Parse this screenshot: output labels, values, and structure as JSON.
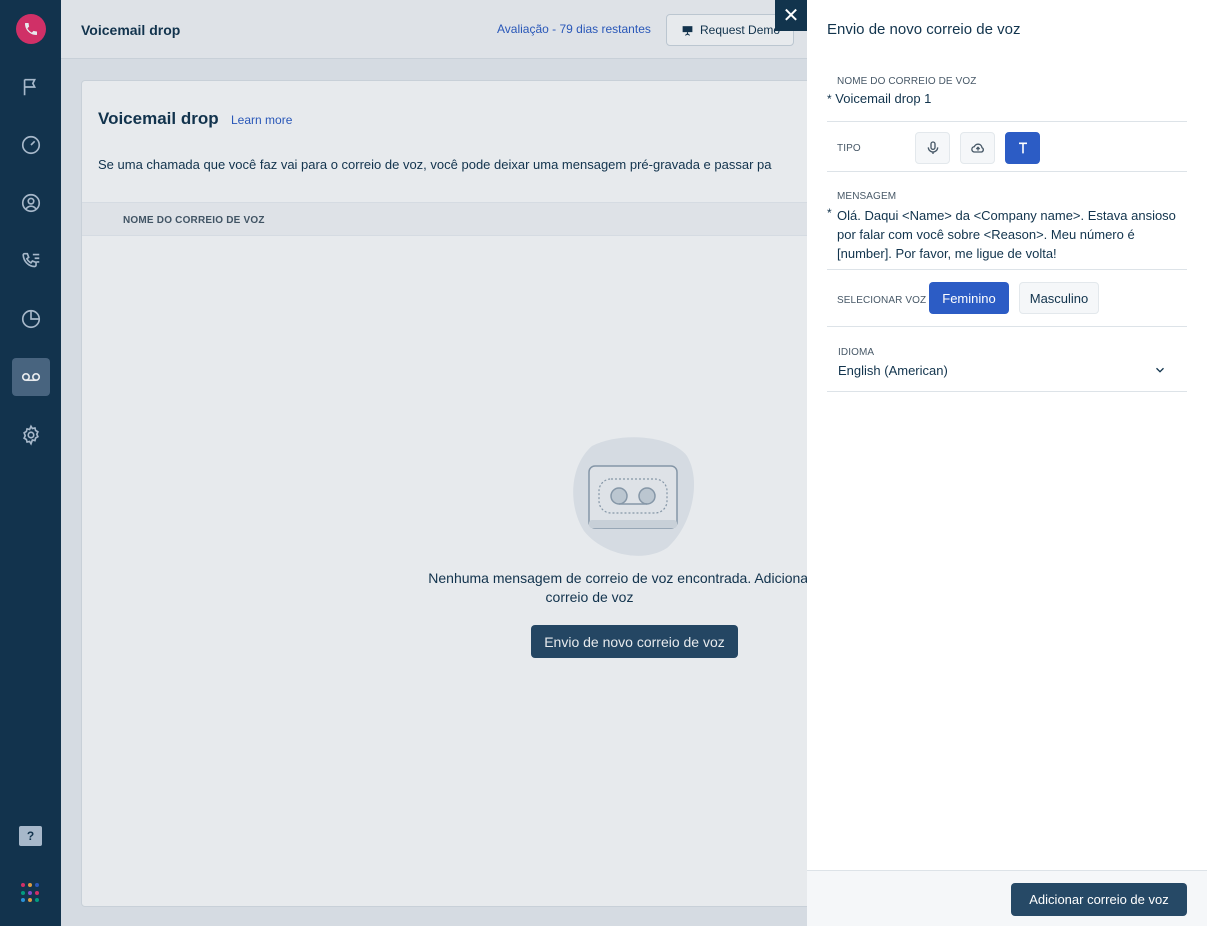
{
  "topbar": {
    "title": "Voicemail drop",
    "trial": "Avaliação - 79 dias restantes",
    "demo_label": "Request Demo"
  },
  "card": {
    "title": "Voicemail drop",
    "learn_more": "Learn more",
    "description": "Se uma chamada que você faz vai para o correio de voz, você pode deixar uma mensagem pré-gravada e passar pa",
    "column_name": "NOME DO CORREIO DE VOZ",
    "empty_line1": "Nenhuma mensagem de correio de voz encontrada. Adicionar mer",
    "empty_line2": "correio de voz",
    "empty_button": "Envio de novo correio de voz"
  },
  "panel": {
    "title": "Envio de novo correio de voz",
    "name_label": "NOME DO CORREIO DE VOZ",
    "name_value": "Voicemail drop 1",
    "required_mark": "*",
    "type_label": "TIPO",
    "message_label": "MENSAGEM",
    "message_value": "Olá. Daqui <Name> da <Company name>. Estava ansioso por falar com você sobre <Reason>. Meu número é [number]. Por favor, me ligue de volta!",
    "voice_label": "SELECIONAR VOZ",
    "voice_female": "Feminino",
    "voice_male": "Masculino",
    "language_label": "IDIOMA",
    "language_value": "English (American)",
    "add_button": "Adicionar correio de voz",
    "close_symbol": "✕"
  },
  "sidebar": {
    "help_symbol": "?",
    "items": [
      "phone-logo",
      "flag-icon",
      "gauge-icon",
      "contact-icon",
      "call-list-icon",
      "pie-chart-icon",
      "voicemail-icon",
      "gear-icon"
    ],
    "active_item": "voicemail-icon"
  },
  "colors": {
    "sidebar": "#12344d",
    "accent": "#2c5cc5",
    "logo": "#e6306a",
    "primary_button": "#264966"
  }
}
